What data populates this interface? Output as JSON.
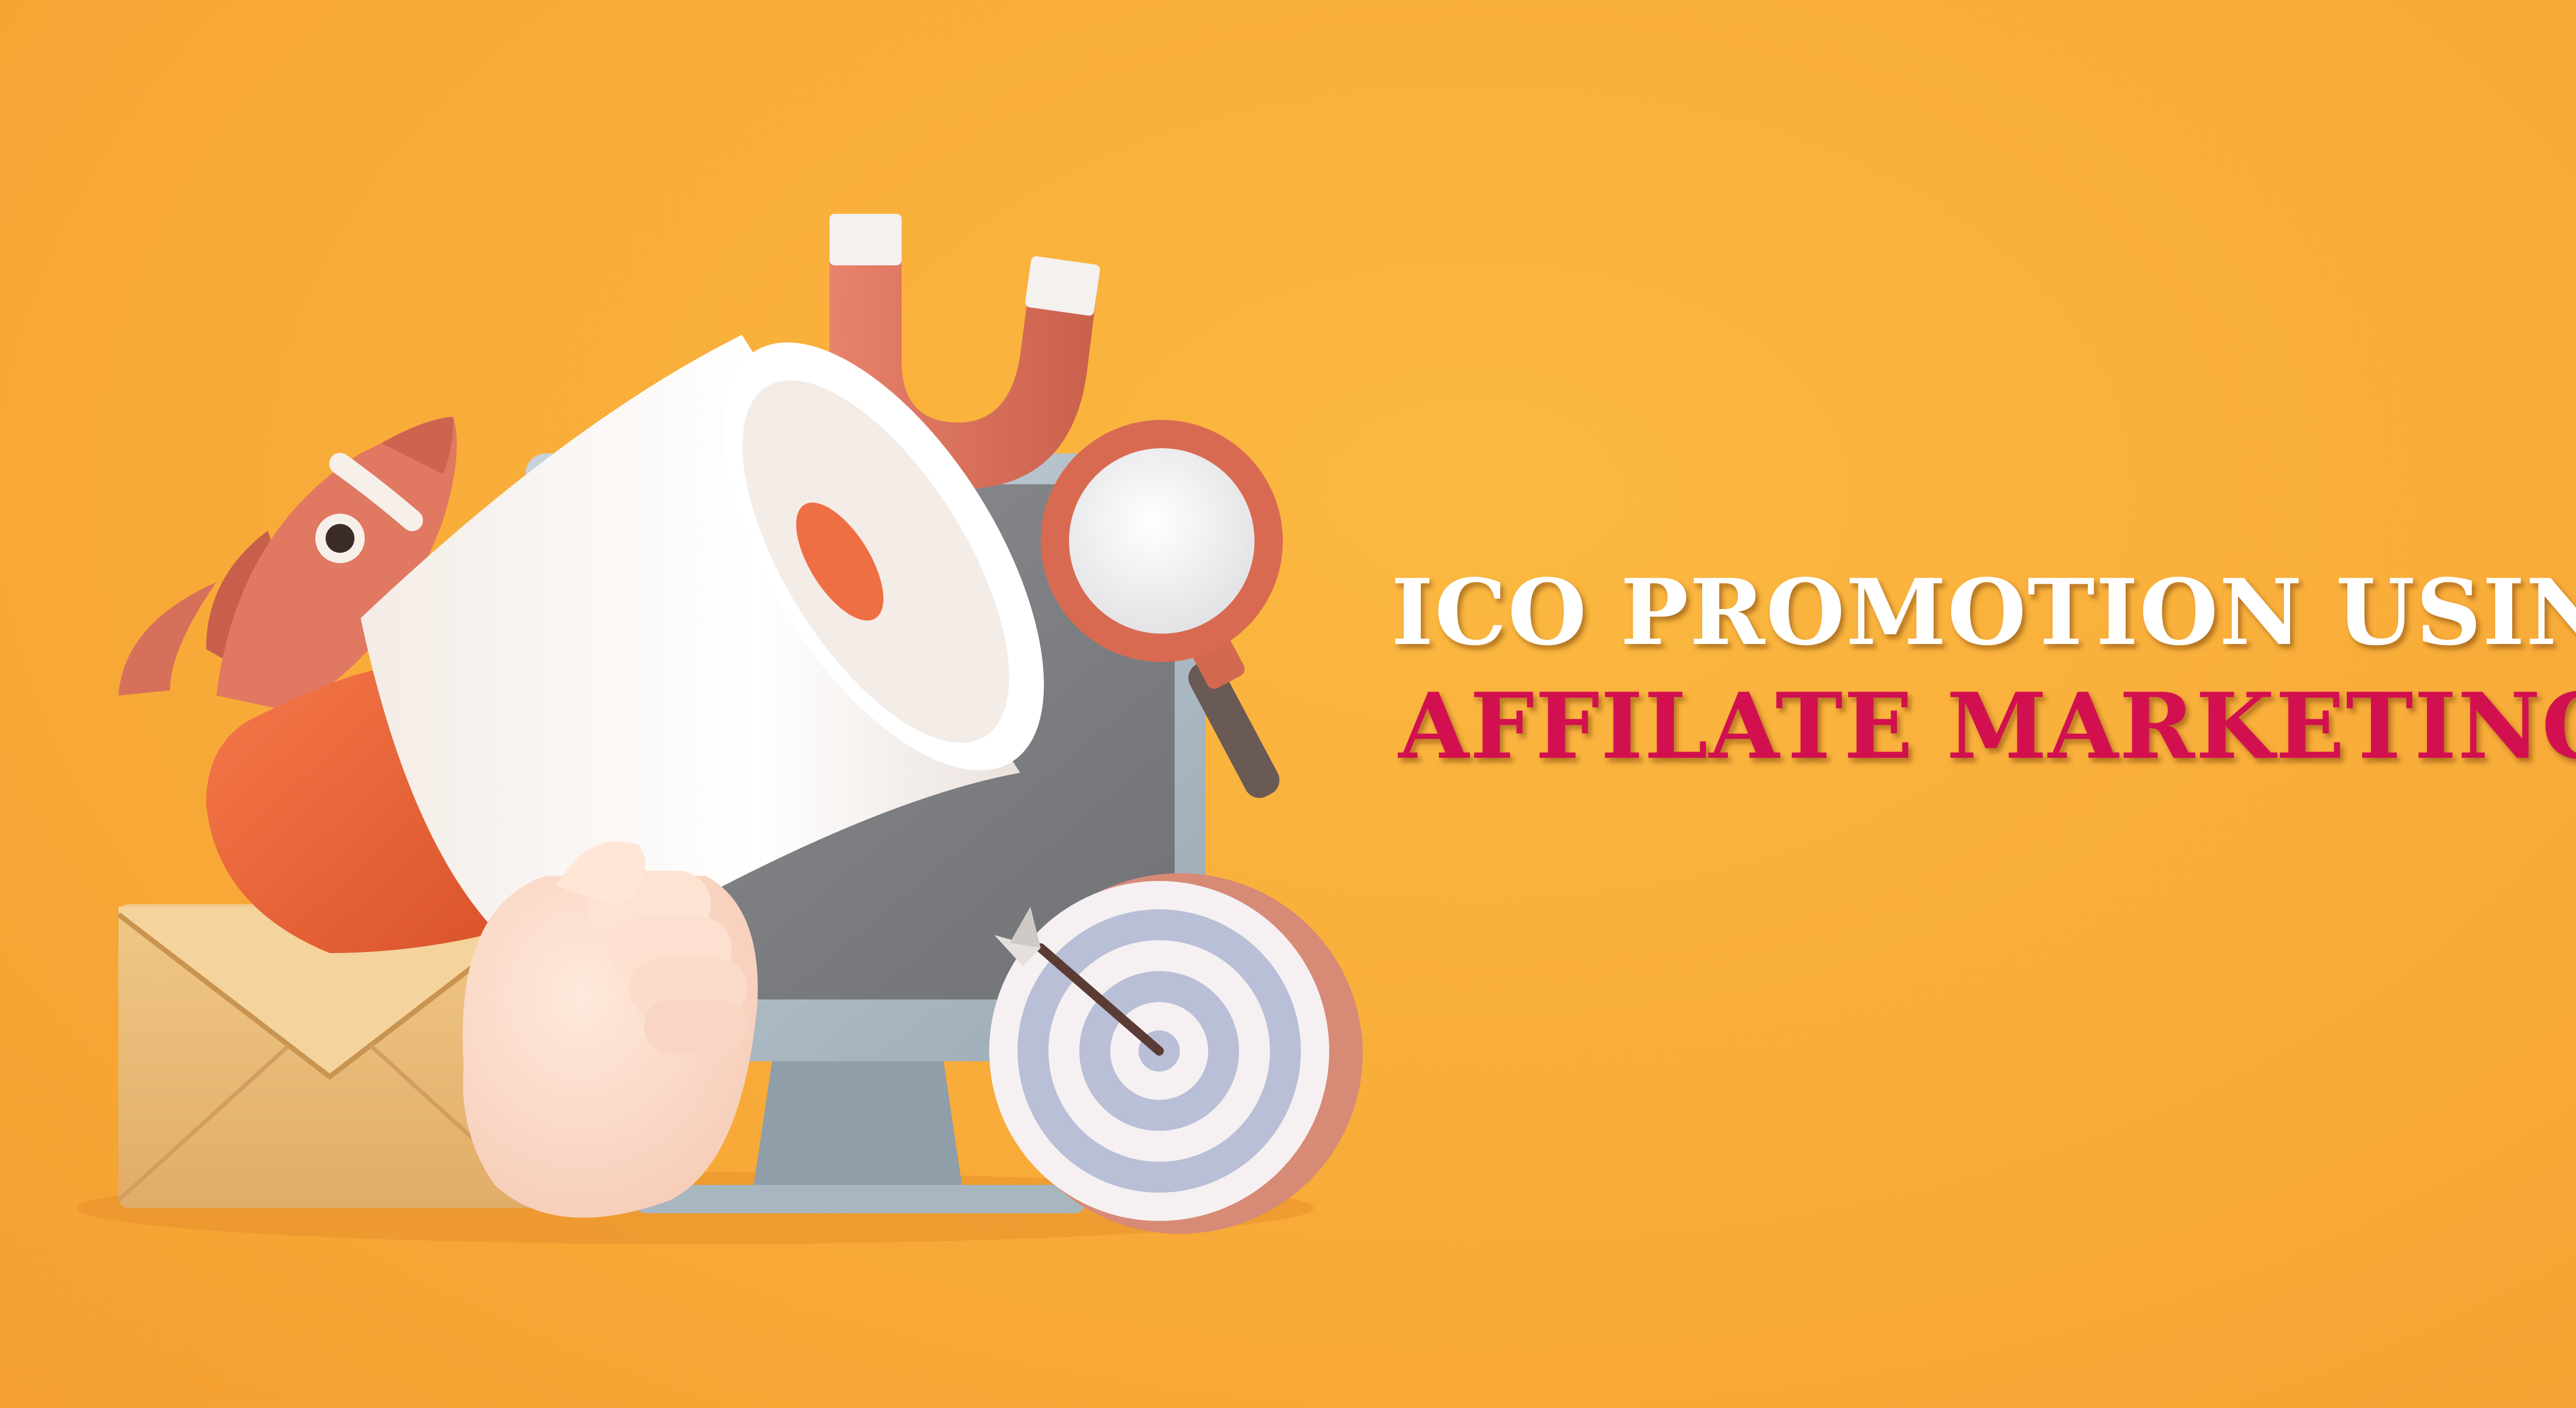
{
  "banner": {
    "line1": "ICO PROMOTION USING",
    "line2": "AFFILATE MARKETING"
  },
  "illustration": {
    "objects": [
      "rocket-icon",
      "megaphone-icon",
      "magnet-icon",
      "monitor-icon",
      "magnifier-icon",
      "envelope-icon",
      "target-icon",
      "hand"
    ]
  },
  "colors": {
    "background": "#f9ae3a",
    "title_white": "#ffffff",
    "title_accent": "#d3104f",
    "coral": "#e07862",
    "megaphone_orange": "#f06a3a"
  }
}
